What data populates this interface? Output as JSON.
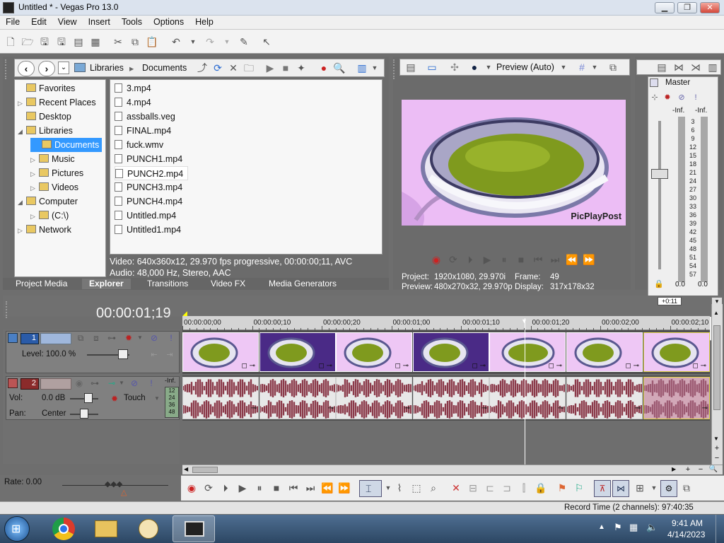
{
  "window": {
    "title": "Untitled * - Vegas Pro 13.0",
    "min": "▁",
    "max": "❐",
    "close": "✕"
  },
  "menu": [
    "File",
    "Edit",
    "View",
    "Insert",
    "Tools",
    "Options",
    "Help"
  ],
  "explorer": {
    "breadcrumb": [
      "Libraries",
      "Documents"
    ],
    "tree": [
      {
        "label": "Favorites",
        "indent": 0,
        "arrow": ""
      },
      {
        "label": "Recent Places",
        "indent": 0,
        "arrow": "▷"
      },
      {
        "label": "Desktop",
        "indent": 0,
        "arrow": ""
      },
      {
        "label": "Libraries",
        "indent": 0,
        "arrow": "◢"
      },
      {
        "label": "Documents",
        "indent": 1,
        "arrow": "",
        "selected": true
      },
      {
        "label": "Music",
        "indent": 1,
        "arrow": "▷"
      },
      {
        "label": "Pictures",
        "indent": 1,
        "arrow": "▷"
      },
      {
        "label": "Videos",
        "indent": 1,
        "arrow": "▷"
      },
      {
        "label": "Computer",
        "indent": 0,
        "arrow": "◢"
      },
      {
        "label": "(C:\\)",
        "indent": 1,
        "arrow": "▷"
      },
      {
        "label": "Network",
        "indent": 0,
        "arrow": "▷"
      }
    ],
    "files": [
      "3.mp4",
      "4.mp4",
      "assballs.veg",
      "FINAL.mp4",
      "fuck.wmv",
      "PUNCH1.mp4",
      "PUNCH2.mp4",
      "PUNCH3.mp4",
      "PUNCH4.mp4",
      "Untitled.mp4",
      "Untitled1.mp4"
    ],
    "selected_file": "PUNCH2.mp4",
    "info_video": "Video: 640x360x12, 29.970 fps progressive, 00:00:00;11, AVC",
    "info_audio": "Audio: 48,000 Hz, Stereo, AAC",
    "tabs": [
      "Project Media",
      "Explorer",
      "Transitions",
      "Video FX",
      "Media Generators"
    ],
    "active_tab": "Explorer"
  },
  "preview": {
    "mode": "Preview (Auto)",
    "watermark": "PicPlayPost",
    "project_label": "Project:",
    "project_value": "1920x1080, 29.970i",
    "preview_label": "Preview:",
    "preview_value": "480x270x32, 29.970p",
    "frame_label": "Frame:",
    "frame_value": "49",
    "display_label": "Display:",
    "display_value": "317x178x32"
  },
  "master": {
    "title": "Master",
    "inf_left": "-Inf.",
    "inf_right": "-Inf.",
    "scale": [
      "3",
      "6",
      "9",
      "12",
      "15",
      "18",
      "21",
      "24",
      "27",
      "30",
      "33",
      "36",
      "39",
      "42",
      "45",
      "48",
      "51",
      "54",
      "57"
    ],
    "out_left": "0.0",
    "out_right": "0.0"
  },
  "timeline": {
    "timecode": "00:00:01;19",
    "marker": "+0:11",
    "ruler": [
      "00:00:00;00",
      "00:00:00;10",
      "00:00:00;20",
      "00:00:01;00",
      "00:00:01;10",
      "00:00:01;20",
      "00:00:02;00",
      "00:00:02;10"
    ],
    "video_track": {
      "number": "1",
      "level": "Level: 100.0 %"
    },
    "audio_track": {
      "number": "2",
      "vol_label": "Vol:",
      "vol_value": "0.0 dB",
      "pan_label": "Pan:",
      "pan_value": "Center",
      "mode": "Touch",
      "inf": "-Inf.",
      "meter": [
        "12",
        "24",
        "36",
        "48"
      ]
    },
    "rate": "Rate: 0.00"
  },
  "status": {
    "record_time": "Record Time (2 channels): 97:40:35"
  },
  "taskbar": {
    "time": "9:41 AM",
    "date": "4/14/2023"
  },
  "colors": {
    "accent": "#3399ff",
    "wave": "#8b3a4a",
    "video_bg": "#e8b7f2"
  }
}
